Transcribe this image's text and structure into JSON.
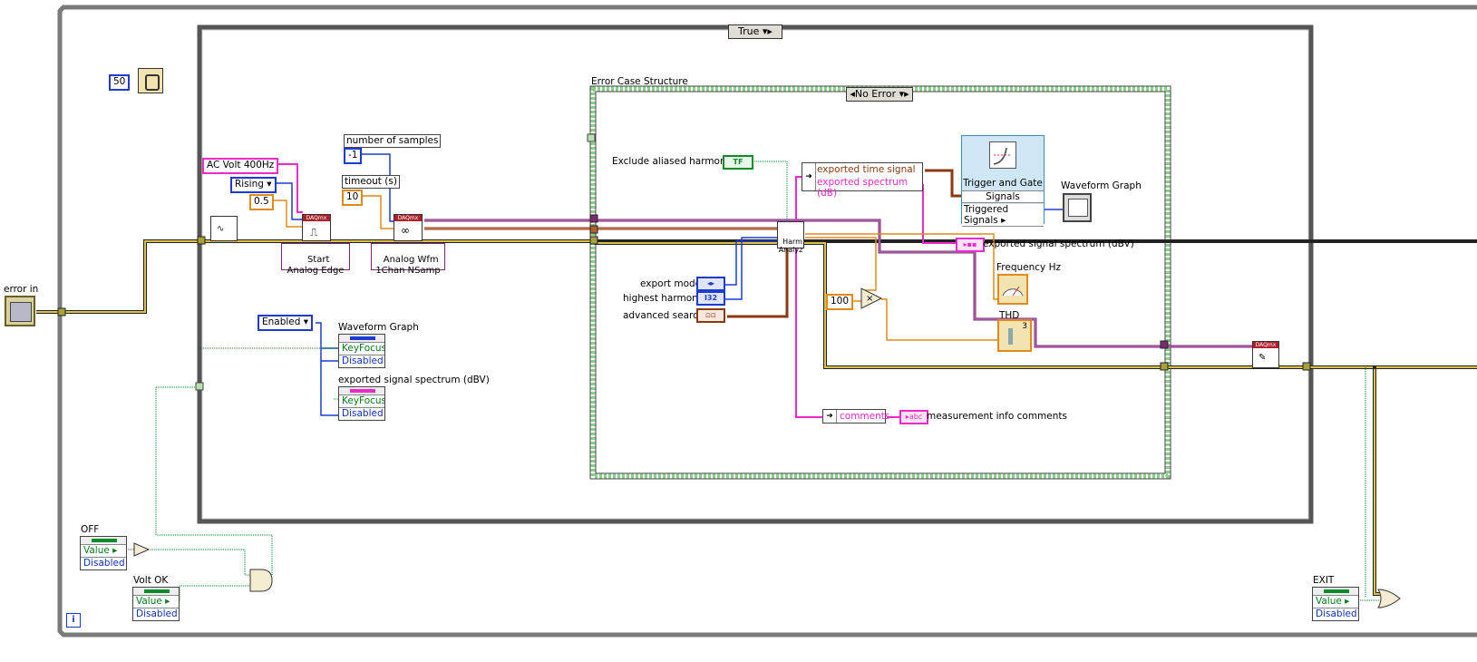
{
  "outer_case": {
    "selector": "True"
  },
  "timer": {
    "value": "50"
  },
  "error_in": {
    "label": "error in"
  },
  "error_case": {
    "label": "Error Case Structure",
    "selector": "No Error"
  },
  "daq": {
    "channel": "AC Volt 400Hz",
    "edge": "Rising",
    "level": "0.5",
    "start_label": "Start\nAnalog Edge",
    "samples_label": "number of samples",
    "samples_value": "-1",
    "timeout_label": "timeout (s)",
    "timeout_value": "10",
    "read_label": "Analog Wfm\n1Chan NSamp"
  },
  "enable": {
    "value": "Enabled"
  },
  "graph_props": {
    "graph1": "Waveform Graph",
    "graph2": "exported signal spectrum (dBV)",
    "row_keyfocus": "KeyFocus",
    "row_disabled": "Disabled"
  },
  "harmonic": {
    "exclude_label": "Exclude aliased harmonics",
    "exclude_value": "TF",
    "export_mode": "export mode",
    "highest_harmonic": "highest harmonic",
    "advanced_search": "advanced search",
    "node": "Harm.\nAnalyz",
    "out_time": "exported time signal",
    "out_spectrum": "exported spectrum (dB)",
    "comments": "comments",
    "comments_ind": "measurement info comments"
  },
  "trigger": {
    "title": "Trigger and Gate",
    "signals": "Signals",
    "triggered": "Triggered Signals"
  },
  "indicators": {
    "waveform_graph": "Waveform Graph",
    "spectrum": "exported signal spectrum (dBV)",
    "frequency": "Frequency Hz",
    "thd": "THD",
    "hundred": "100",
    "thd_num": "3"
  },
  "loop_controls": {
    "off_label": "OFF",
    "volt_ok_label": "Volt OK",
    "exit_label": "EXIT",
    "value": "Value",
    "disabled": "Disabled",
    "iteration": "i"
  },
  "colors": {
    "error_wire": "#d8c24a",
    "task_wire": "#7b2a70",
    "numeric_orange": "#e08a1a",
    "numeric_blue": "#1f3ad0",
    "string_pink": "#ea2aca",
    "boolean_green": "#0a8a2a",
    "structure_grey": "#7a7a7a",
    "case_green": "#8ccf8c"
  }
}
